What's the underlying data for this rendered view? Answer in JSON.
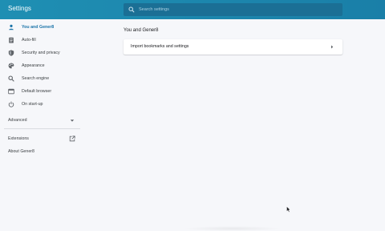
{
  "header": {
    "title": "Settings",
    "search_placeholder": "Search settings"
  },
  "sidebar": {
    "items": [
      {
        "label": "You and Gener8",
        "icon": "person-icon",
        "active": true
      },
      {
        "label": "Auto-fill",
        "icon": "clipboard-icon",
        "active": false
      },
      {
        "label": "Security and privacy",
        "icon": "shield-icon",
        "active": false
      },
      {
        "label": "Appearance",
        "icon": "palette-icon",
        "active": false
      },
      {
        "label": "Search engine",
        "icon": "search-icon",
        "active": false
      },
      {
        "label": "Default browser",
        "icon": "browser-icon",
        "active": false
      },
      {
        "label": "On start-up",
        "icon": "power-icon",
        "active": false
      }
    ],
    "advanced_label": "Advanced",
    "extensions_label": "Extensions",
    "about_label": "About Gener8"
  },
  "main": {
    "section_title": "You and Gener8",
    "card_label": "Import bookmarks and settings"
  },
  "colors": {
    "header": "#1f8fb3",
    "accent": "#1a73a8",
    "background": "#f6f7fa"
  }
}
